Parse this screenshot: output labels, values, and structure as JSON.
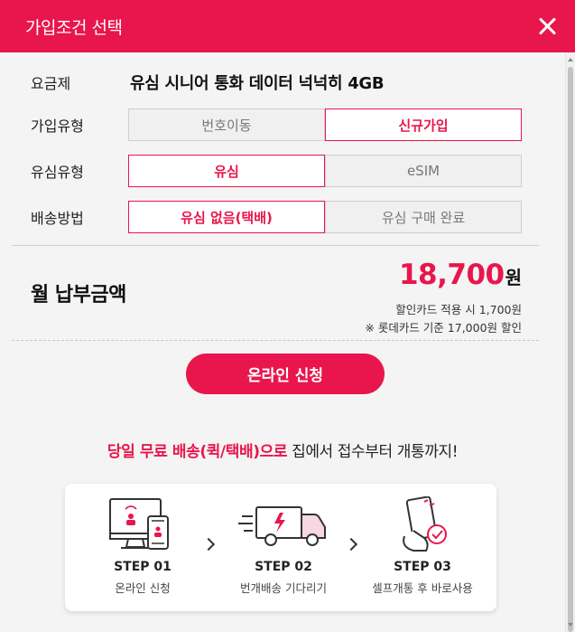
{
  "header": {
    "title": "가입조건 선택"
  },
  "plan": {
    "label": "요금제",
    "name": "유심 시니어 통화 데이터 넉넉히 4GB"
  },
  "join_type": {
    "label": "가입유형",
    "options": [
      "번호이동",
      "신규가입"
    ],
    "selected": "신규가입"
  },
  "sim_type": {
    "label": "유심유형",
    "options": [
      "유심",
      "eSIM"
    ],
    "selected": "유심"
  },
  "delivery": {
    "label": "배송방법",
    "options": [
      "유심 없음(택배)",
      "유심 구매 완료"
    ],
    "selected": "유심 없음(택배)"
  },
  "payment": {
    "label": "월 납부금액",
    "amount": "18,700",
    "unit": "원",
    "discount_note": "할인카드 적용 시 1,700원",
    "card_note": "※ 롯데카드 기준 17,000원 할인"
  },
  "apply_button": {
    "label": "온라인 신청"
  },
  "promo": {
    "highlight": "당일 무료 배송(퀵/택배)으로",
    "rest": " 집에서 접수부터 개통까지!"
  },
  "steps": [
    {
      "title": "STEP 01",
      "desc": "온라인 신청",
      "icon": "computer-phone-icon"
    },
    {
      "title": "STEP 02",
      "desc": "번개배송 기다리기",
      "icon": "delivery-truck-icon"
    },
    {
      "title": "STEP 03",
      "desc": "셀프개통 후 바로사용",
      "icon": "phone-check-icon"
    }
  ],
  "colors": {
    "accent": "#e8164c",
    "background": "#f4f4f4"
  }
}
